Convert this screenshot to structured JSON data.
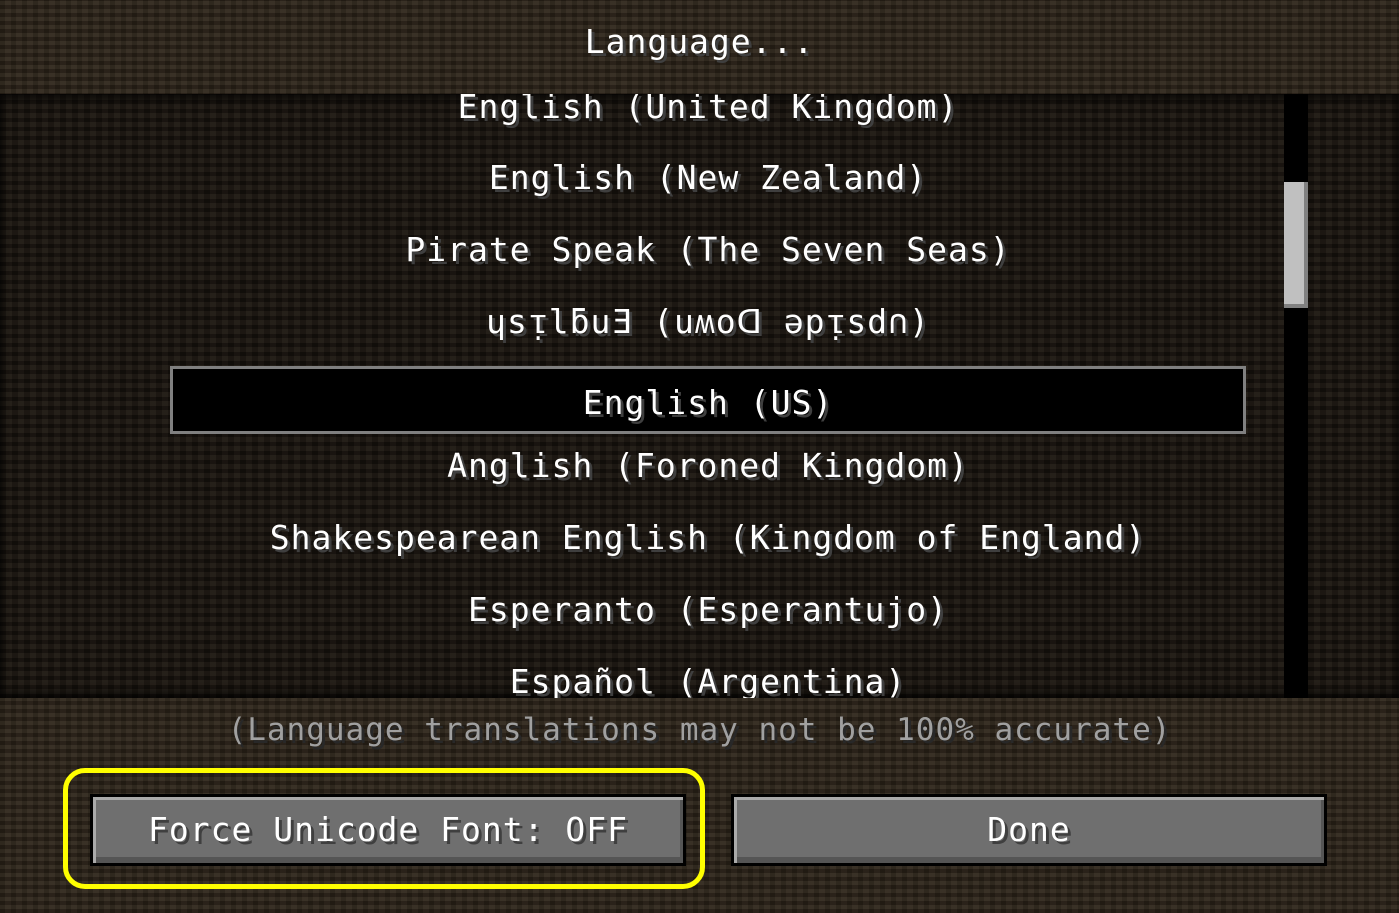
{
  "header": {
    "title": "Language..."
  },
  "language_list": {
    "items": [
      {
        "label": "English (United Kingdom)",
        "selected": false
      },
      {
        "label": "English (New Zealand)",
        "selected": false
      },
      {
        "label": "Pirate Speak (The Seven Seas)",
        "selected": false
      },
      {
        "label": "ɥsᴉlƃuƎ (uʍoᗡ ǝpᴉsd∩)",
        "selected": false
      },
      {
        "label": "English (US)",
        "selected": true
      },
      {
        "label": "Anglish (Foroned Kingdom)",
        "selected": false
      },
      {
        "label": "Shakespearean English (Kingdom of England)",
        "selected": false
      },
      {
        "label": "Esperanto (Esperantujo)",
        "selected": false
      },
      {
        "label": "Español (Argentina)",
        "selected": false
      }
    ]
  },
  "footer": {
    "note": "(Language translations may not be 100% accurate)",
    "force_unicode_label": "Force Unicode Font: OFF",
    "done_label": "Done"
  },
  "colors": {
    "highlight_ring": "#ffff00",
    "selected_border": "#808080",
    "text": "#ffffff",
    "note_text": "#a0a0a0"
  }
}
